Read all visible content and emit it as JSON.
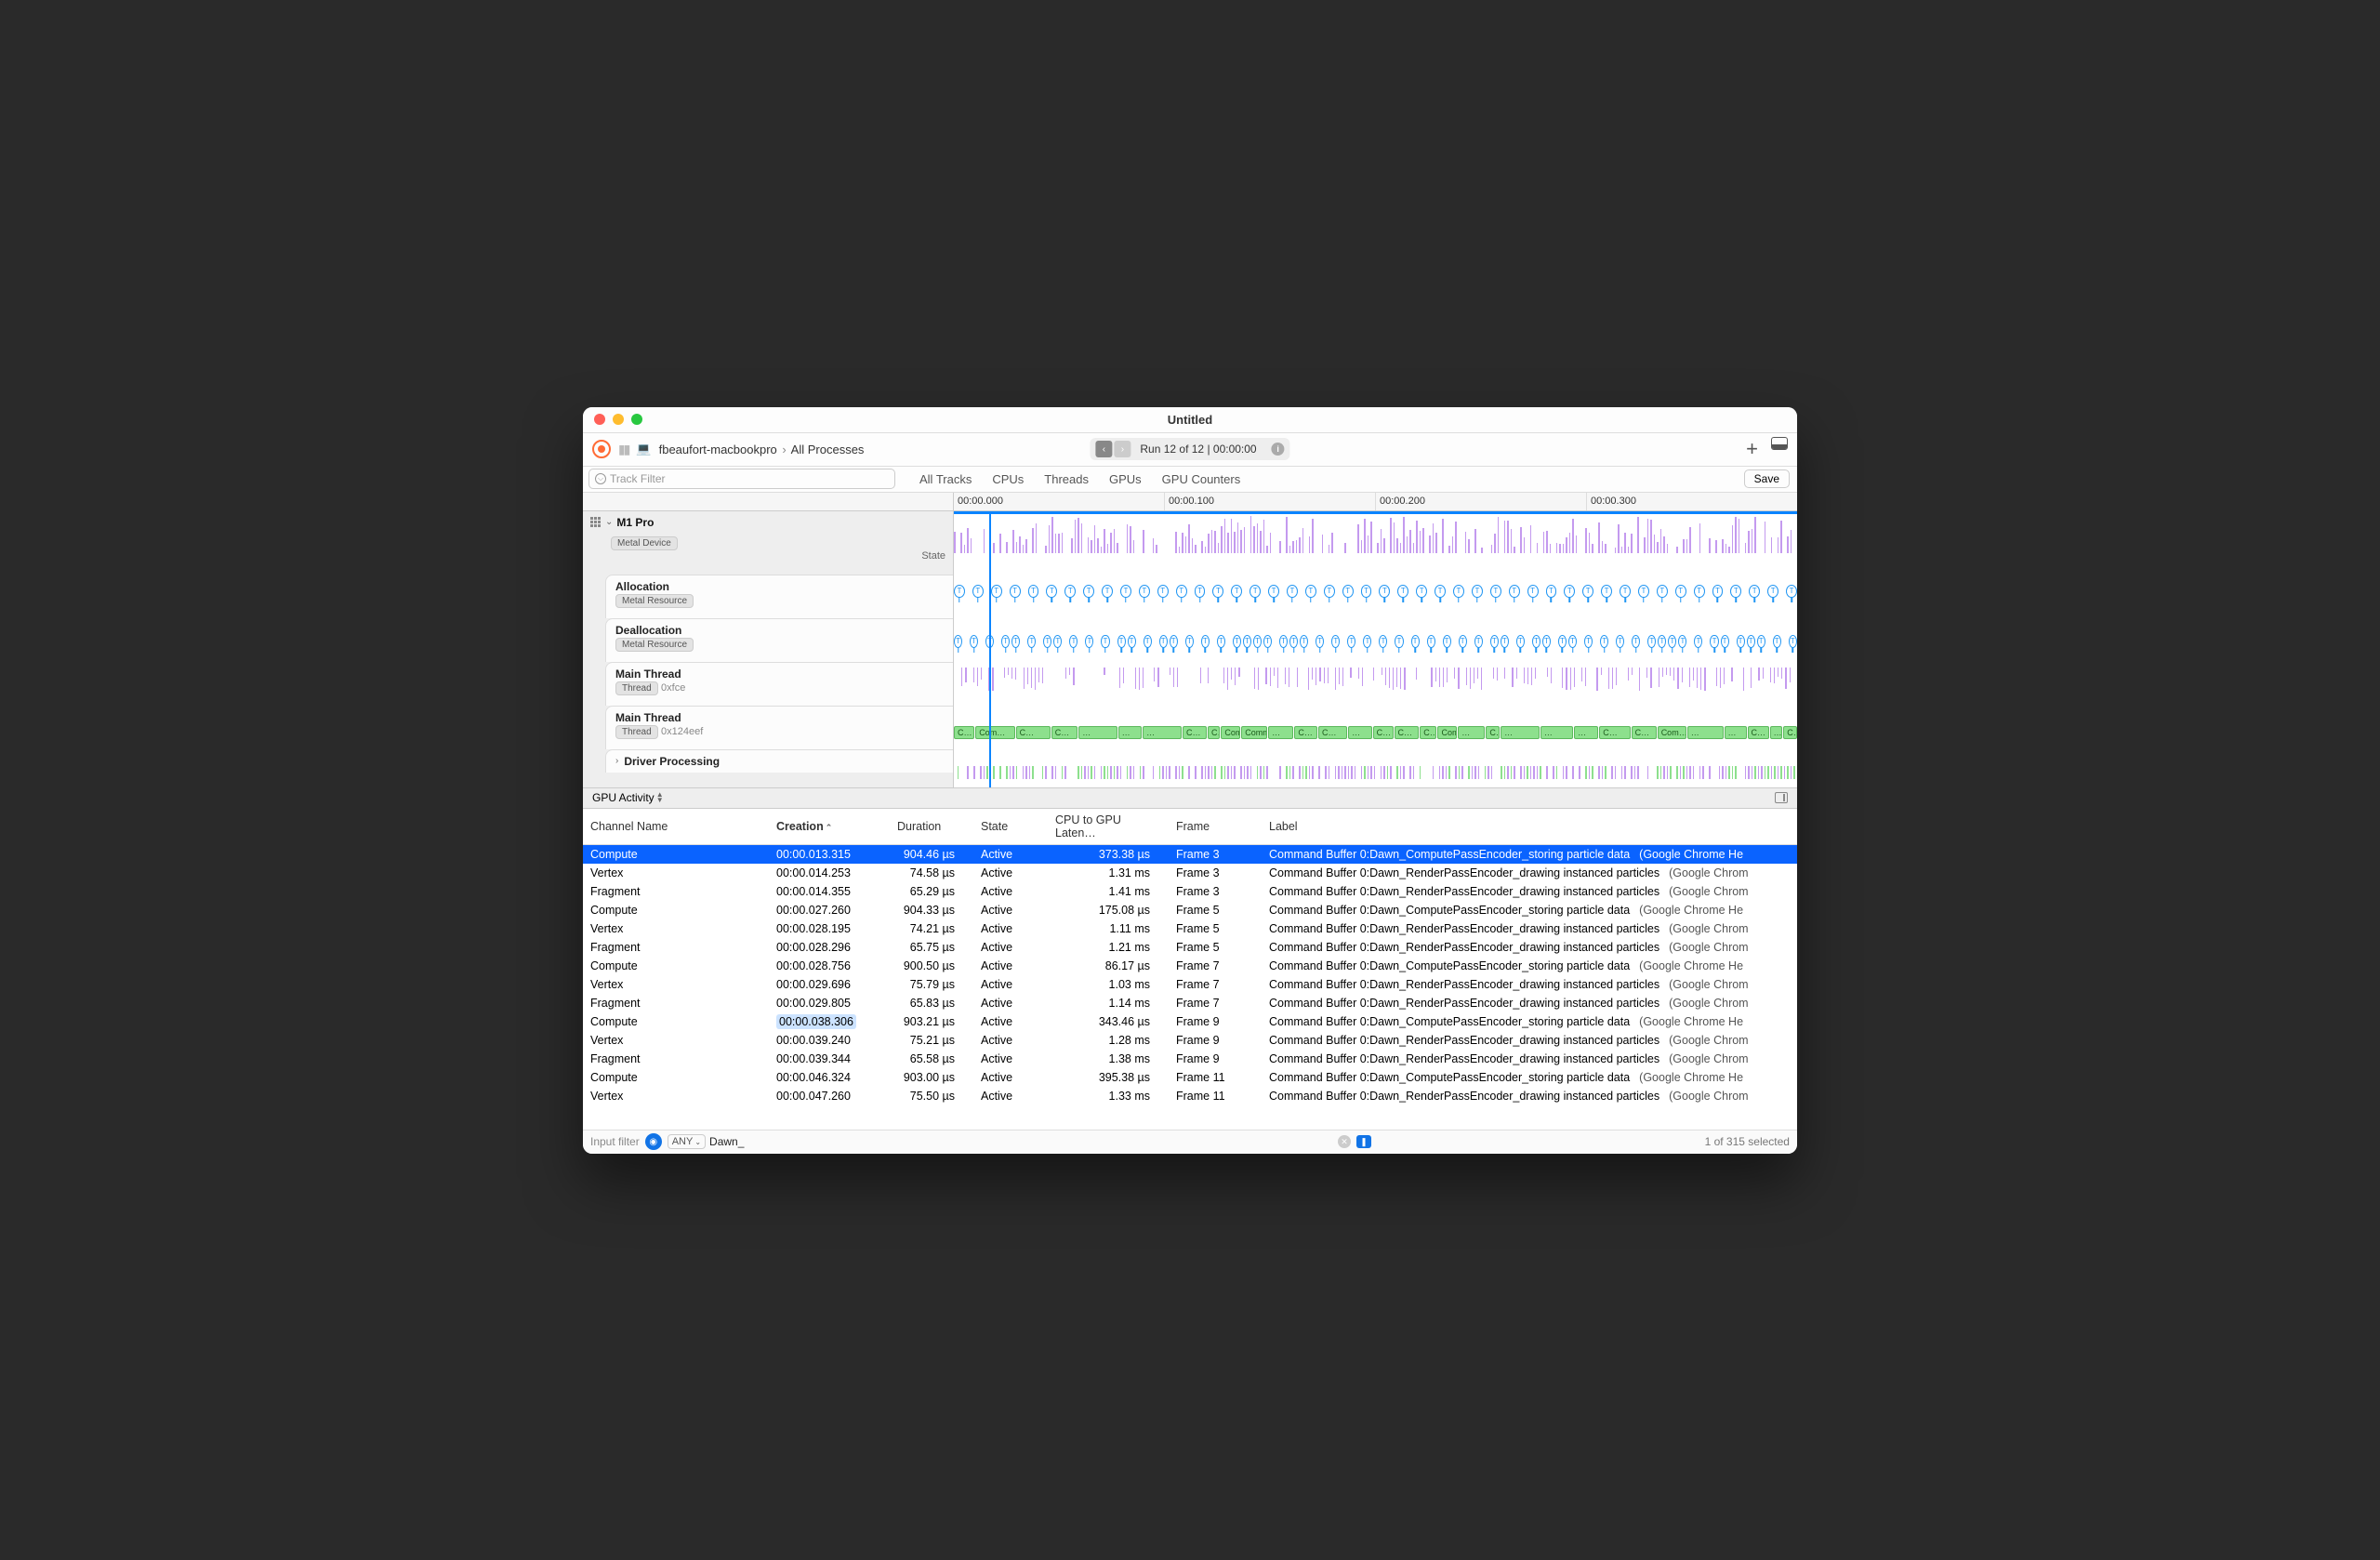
{
  "window": {
    "title": "Untitled"
  },
  "breadcrumb": {
    "host": "fbeaufort-macbookpro",
    "scope": "All Processes"
  },
  "run_mini": {
    "text": "Run 12 of 12  |  00:00:00"
  },
  "track_filter": {
    "placeholder": "Track Filter"
  },
  "tabs": {
    "all_tracks": "All Tracks",
    "cpus": "CPUs",
    "threads": "Threads",
    "gpus": "GPUs",
    "gpu_counters": "GPU Counters"
  },
  "save_label": "Save",
  "ruler": {
    "t0": "00:00.000",
    "t1": "00:00.100",
    "t2": "00:00.200",
    "t3": "00:00.300"
  },
  "tracks": {
    "root": {
      "name": "M1 Pro",
      "chip": "Metal Device",
      "state": "State"
    },
    "allocation": {
      "name": "Allocation",
      "chip": "Metal Resource"
    },
    "deallocation": {
      "name": "Deallocation",
      "chip": "Metal Resource"
    },
    "thread1": {
      "name": "Main Thread",
      "chip": "Thread",
      "sub": "0xfce"
    },
    "thread2": {
      "name": "Main Thread",
      "chip": "Thread",
      "sub": "0x124eef"
    },
    "driver": {
      "name": "Driver Processing"
    }
  },
  "cmd_labels": [
    "C…",
    "Com…",
    "C…",
    "C…",
    "…",
    "…",
    "…",
    "C…",
    "C…",
    "Com…",
    "Comm…",
    "…",
    "C…",
    "C…",
    "…",
    "C…",
    "C…",
    "C…",
    "Com…",
    "…",
    "C…",
    "…",
    "…",
    "…",
    "C…",
    "C…",
    "Com…",
    "…",
    "…",
    "C…",
    "…",
    "C…"
  ],
  "section": {
    "name": "GPU Activity"
  },
  "columns": {
    "channel": "Channel Name",
    "creation": "Creation",
    "duration": "Duration",
    "state": "State",
    "latency": "CPU to GPU Laten…",
    "frame": "Frame",
    "label": "Label"
  },
  "rows": [
    {
      "ch": "Compute",
      "cr": "00:00.013.315",
      "du": "904.46 µs",
      "st": "Active",
      "la": "373.38 µs",
      "fr": "Frame 3",
      "lb": "Command Buffer 0:Dawn_ComputePassEncoder_storing particle data",
      "pr": "(Google Chrome He",
      "sel": true,
      "hl": false
    },
    {
      "ch": "Vertex",
      "cr": "00:00.014.253",
      "du": "74.58 µs",
      "st": "Active",
      "la": "1.31 ms",
      "fr": "Frame 3",
      "lb": "Command Buffer 0:Dawn_RenderPassEncoder_drawing instanced particles",
      "pr": "(Google Chrom",
      "sel": false,
      "hl": false
    },
    {
      "ch": "Fragment",
      "cr": "00:00.014.355",
      "du": "65.29 µs",
      "st": "Active",
      "la": "1.41 ms",
      "fr": "Frame 3",
      "lb": "Command Buffer 0:Dawn_RenderPassEncoder_drawing instanced particles",
      "pr": "(Google Chrom",
      "sel": false,
      "hl": false
    },
    {
      "ch": "Compute",
      "cr": "00:00.027.260",
      "du": "904.33 µs",
      "st": "Active",
      "la": "175.08 µs",
      "fr": "Frame 5",
      "lb": "Command Buffer 0:Dawn_ComputePassEncoder_storing particle data",
      "pr": "(Google Chrome He",
      "sel": false,
      "hl": false
    },
    {
      "ch": "Vertex",
      "cr": "00:00.028.195",
      "du": "74.21 µs",
      "st": "Active",
      "la": "1.11 ms",
      "fr": "Frame 5",
      "lb": "Command Buffer 0:Dawn_RenderPassEncoder_drawing instanced particles",
      "pr": "(Google Chrom",
      "sel": false,
      "hl": false
    },
    {
      "ch": "Fragment",
      "cr": "00:00.028.296",
      "du": "65.75 µs",
      "st": "Active",
      "la": "1.21 ms",
      "fr": "Frame 5",
      "lb": "Command Buffer 0:Dawn_RenderPassEncoder_drawing instanced particles",
      "pr": "(Google Chrom",
      "sel": false,
      "hl": false
    },
    {
      "ch": "Compute",
      "cr": "00:00.028.756",
      "du": "900.50 µs",
      "st": "Active",
      "la": "86.17 µs",
      "fr": "Frame 7",
      "lb": "Command Buffer 0:Dawn_ComputePassEncoder_storing particle data",
      "pr": "(Google Chrome He",
      "sel": false,
      "hl": false
    },
    {
      "ch": "Vertex",
      "cr": "00:00.029.696",
      "du": "75.79 µs",
      "st": "Active",
      "la": "1.03 ms",
      "fr": "Frame 7",
      "lb": "Command Buffer 0:Dawn_RenderPassEncoder_drawing instanced particles",
      "pr": "(Google Chrom",
      "sel": false,
      "hl": false
    },
    {
      "ch": "Fragment",
      "cr": "00:00.029.805",
      "du": "65.83 µs",
      "st": "Active",
      "la": "1.14 ms",
      "fr": "Frame 7",
      "lb": "Command Buffer 0:Dawn_RenderPassEncoder_drawing instanced particles",
      "pr": "(Google Chrom",
      "sel": false,
      "hl": false
    },
    {
      "ch": "Compute",
      "cr": "00:00.038.306",
      "du": "903.21 µs",
      "st": "Active",
      "la": "343.46 µs",
      "fr": "Frame 9",
      "lb": "Command Buffer 0:Dawn_ComputePassEncoder_storing particle data",
      "pr": "(Google Chrome He",
      "sel": false,
      "hl": true
    },
    {
      "ch": "Vertex",
      "cr": "00:00.039.240",
      "du": "75.21 µs",
      "st": "Active",
      "la": "1.28 ms",
      "fr": "Frame 9",
      "lb": "Command Buffer 0:Dawn_RenderPassEncoder_drawing instanced particles",
      "pr": "(Google Chrom",
      "sel": false,
      "hl": false
    },
    {
      "ch": "Fragment",
      "cr": "00:00.039.344",
      "du": "65.58 µs",
      "st": "Active",
      "la": "1.38 ms",
      "fr": "Frame 9",
      "lb": "Command Buffer 0:Dawn_RenderPassEncoder_drawing instanced particles",
      "pr": "(Google Chrom",
      "sel": false,
      "hl": false
    },
    {
      "ch": "Compute",
      "cr": "00:00.046.324",
      "du": "903.00 µs",
      "st": "Active",
      "la": "395.38 µs",
      "fr": "Frame 11",
      "lb": "Command Buffer 0:Dawn_ComputePassEncoder_storing particle data",
      "pr": "(Google Chrome He",
      "sel": false,
      "hl": false
    },
    {
      "ch": "Vertex",
      "cr": "00:00.047.260",
      "du": "75.50 µs",
      "st": "Active",
      "la": "1.33 ms",
      "fr": "Frame 11",
      "lb": "Command Buffer 0:Dawn_RenderPassEncoder_drawing instanced particles",
      "pr": "(Google Chrom",
      "sel": false,
      "hl": false
    }
  ],
  "footer": {
    "input_filter_label": "Input filter",
    "any": "ANY",
    "query": "Dawn_",
    "selection": "1 of 315 selected"
  }
}
